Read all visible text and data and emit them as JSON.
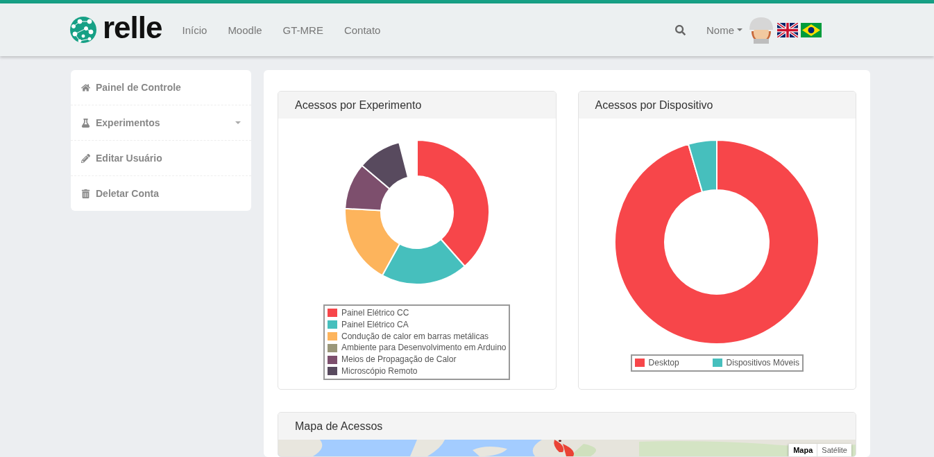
{
  "brand": {
    "name": "relle"
  },
  "nav": {
    "links": [
      {
        "label": "Início"
      },
      {
        "label": "Moodle"
      },
      {
        "label": "GT-MRE"
      },
      {
        "label": "Contato"
      }
    ],
    "user": "Nome"
  },
  "sidebar": {
    "items": [
      {
        "label": "Painel de Controle",
        "expandable": false
      },
      {
        "label": "Experimentos",
        "expandable": true
      },
      {
        "label": "Editar Usuário",
        "expandable": false
      },
      {
        "label": "Deletar Conta",
        "expandable": false
      }
    ]
  },
  "panels": [
    {
      "title": "Acessos por Experimento",
      "legend": [
        {
          "label": "Painel Elétrico CC",
          "color": "#f7464a"
        },
        {
          "label": "Painel Elétrico CA",
          "color": "#46bfbd"
        },
        {
          "label": "Condução de calor em barras metálicas",
          "color": "#fdb45c"
        },
        {
          "label": "Ambiente para Desenvolvimento em Arduino",
          "color": "#9a977a"
        },
        {
          "label": "Meios de Propagação de Calor",
          "color": "#7d4f6d"
        },
        {
          "label": "Microscópio Remoto",
          "color": "#584a5e"
        }
      ]
    },
    {
      "title": "Acessos por Dispositivo",
      "legend": [
        {
          "label": "Desktop",
          "color": "#f7464a"
        },
        {
          "label": "Dispositivos Móveis",
          "color": "#46bfbd"
        }
      ]
    }
  ],
  "map": {
    "title": "Mapa de Acessos",
    "kind": "picture",
    "types": [
      {
        "label": "Mapa",
        "selected": true
      },
      {
        "label": "Satélite",
        "selected": false
      }
    ]
  }
}
